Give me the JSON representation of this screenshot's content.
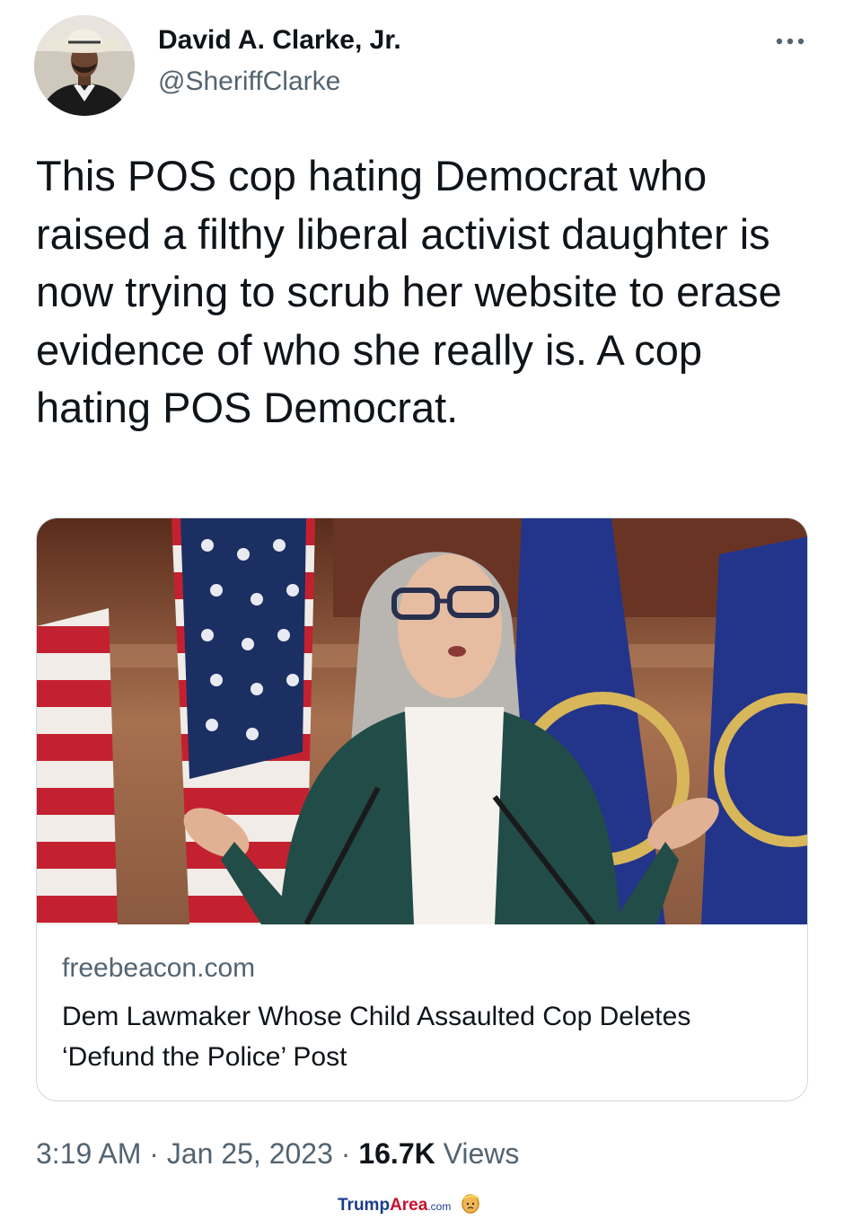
{
  "tweet": {
    "author": {
      "display_name": "David A. Clarke, Jr.",
      "handle": "@SheriffClarke",
      "avatar_icon": "profile-photo-cowboy-hat"
    },
    "more_icon": "more-horizontal-icon",
    "text": "This POS cop hating Democrat who raised a filthy liberal activist daughter is now trying to scrub her website to erase evidence of who she really is. A cop hating POS Democrat.",
    "card": {
      "image_icon": "news-photo",
      "domain": "freebeacon.com",
      "title": "Dem Lawmaker Whose Child Assaulted Cop Deletes ‘Defund the Police’ Post"
    },
    "meta": {
      "time": "3:19 AM",
      "separator_1": " · ",
      "date": "Jan 25, 2023",
      "separator_2": " · ",
      "views_count": "16.7K",
      "views_label": " Views"
    }
  },
  "watermark": {
    "brand_part1": "Trump",
    "brand_part2": "Area",
    "brand_suffix": ".com",
    "icon": "trump-face-icon"
  },
  "colors": {
    "text_primary": "#0f1419",
    "text_secondary": "#536471",
    "card_border": "#cfd9de",
    "watermark_blue": "#1a3c8c",
    "watermark_red": "#c8102e"
  }
}
